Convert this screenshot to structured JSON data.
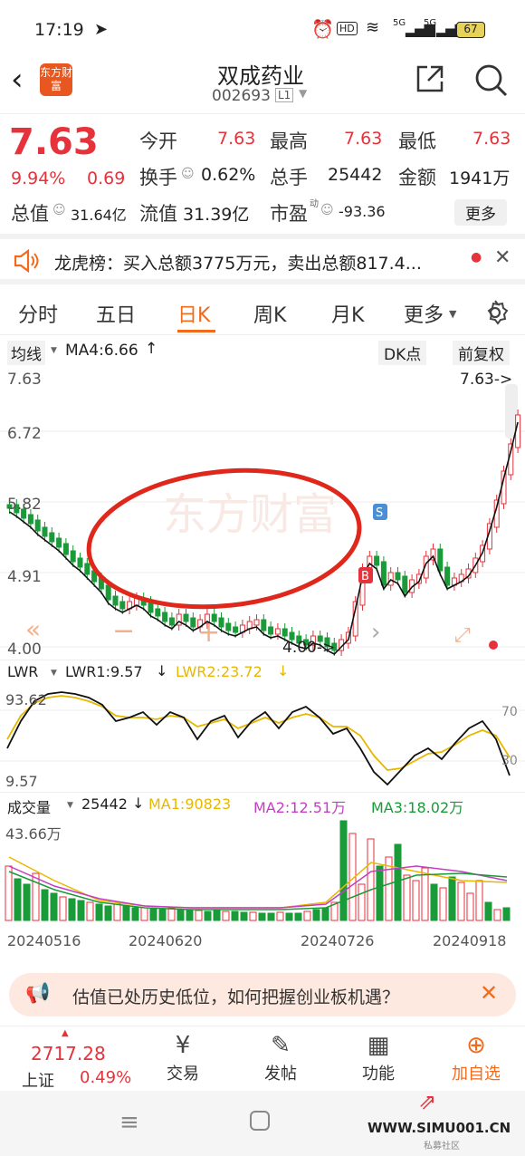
{
  "status_bar": {
    "time": "17:19",
    "battery": "67",
    "hd": "HD",
    "net1": "5G",
    "net2": "5G"
  },
  "header": {
    "back_icon": "chevron-left-icon",
    "logo_text": "东方财富",
    "name": "双成药业",
    "code": "002693",
    "level": "L1",
    "share_icon": "share-icon",
    "search_icon": "search-icon"
  },
  "quote": {
    "price": "7.63",
    "pct": "9.94%",
    "chg": "0.69",
    "open_label": "今开",
    "open": "7.63",
    "high_label": "最高",
    "high": "7.63",
    "low_label": "最低",
    "low": "7.63",
    "turnover_label": "换手",
    "turnover": "0.62%",
    "volume_label": "总手",
    "volume": "25442",
    "amount_label": "金额",
    "amount": "1941万",
    "mktcap_label": "总值",
    "mktcap": "31.64亿",
    "float_label": "流值",
    "float": "31.39亿",
    "pe_label": "市盈",
    "pe_sup": "动",
    "pe": "-93.36",
    "more": "更多"
  },
  "news": {
    "text": "龙虎榜：买入总额3775万元，卖出总额817.4..."
  },
  "tabs": [
    "分时",
    "五日",
    "日K",
    "周K",
    "月K",
    "更多"
  ],
  "active_tab": "日K",
  "kchart": {
    "ma_selector": "均线",
    "ma4": "MA4:6.66",
    "dk_btn": "DK点",
    "adjust_btn": "前复权",
    "y_labels": [
      "7.63",
      "6.72",
      "5.82",
      "4.91",
      "4.00"
    ],
    "max_label": "7.63->",
    "min_label": "4.00->",
    "s_mark": "S",
    "b_mark": "B",
    "watermark": "东方财富"
  },
  "lwr": {
    "selector": "LWR",
    "lwr1": "LWR1:9.57",
    "lwr2": "LWR2:23.72",
    "top": "93.62",
    "bottom": "9.57",
    "level70": "70",
    "level30": "30"
  },
  "volume": {
    "selector": "成交量",
    "vol": "25442",
    "ma1": "MA1:90823",
    "ma2": "MA2:12.51万",
    "ma3": "MA3:18.02万",
    "top": "43.66万",
    "dates": [
      "20240516",
      "20240620",
      "20240726",
      "20240918"
    ]
  },
  "banner": {
    "text": "估值已处历史低位，如何把握创业板机遇？"
  },
  "bottom_nav": {
    "index_value": "2717.28",
    "index_name": "上证",
    "index_pct": "0.49%",
    "items": [
      "交易",
      "发帖",
      "功能",
      "加自选"
    ]
  },
  "watermark_site": {
    "text": "WWW.SIMU001.CN",
    "sub": "私募社区"
  },
  "colors": {
    "up": "#e5323b",
    "down": "#1a9a38",
    "accent": "#f26a1b",
    "lwr2": "#e7b800",
    "ma2": "#c23ec2"
  }
}
